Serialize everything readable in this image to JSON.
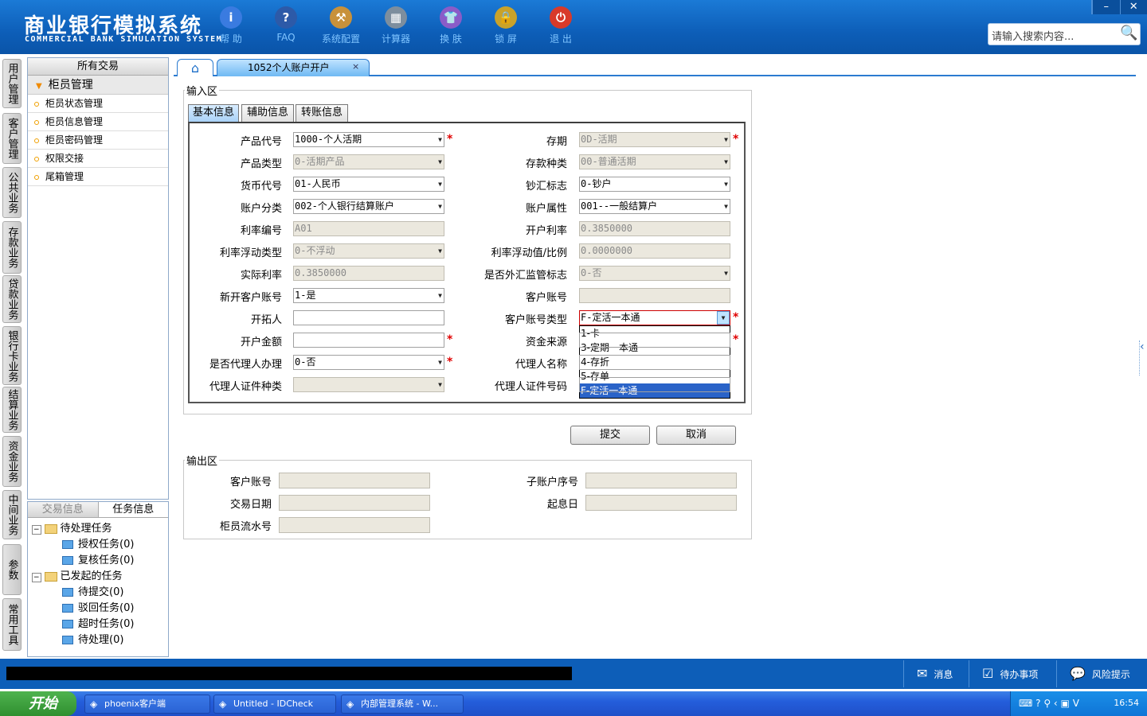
{
  "header": {
    "title_cn": "商业银行模拟系统",
    "title_en": "COMMERCIAL BANK SIMULATION SYSTEM",
    "tools": [
      {
        "label": "帮 助",
        "icon": "info-icon",
        "glyph": "i",
        "color": "#3a7be0"
      },
      {
        "label": "FAQ",
        "icon": "help-icon",
        "glyph": "?",
        "color": "#2d5aa8"
      },
      {
        "label": "系统配置",
        "icon": "toolbox-icon",
        "glyph": "⚒",
        "color": "#c8913a"
      },
      {
        "label": "计算器",
        "icon": "calculator-icon",
        "glyph": "▦",
        "color": "#7d8e9e"
      },
      {
        "label": "换 肤",
        "icon": "tshirt-icon",
        "glyph": "👕",
        "color": "#8a5cc8"
      },
      {
        "label": "锁 屏",
        "icon": "lock-icon",
        "glyph": "🔒",
        "color": "#c9a22a"
      },
      {
        "label": "退 出",
        "icon": "power-icon",
        "glyph": "⏻",
        "color": "#d83a2a"
      }
    ],
    "search_placeholder": "请输入搜索内容...",
    "win_min": "–",
    "win_close": "✕"
  },
  "left_tabs": [
    "用户管理",
    "客户管理",
    "公共业务",
    "存款业务",
    "贷款业务",
    "银行卡业务",
    "结算业务",
    "资金业务",
    "中间业务",
    "参数",
    "常用工具"
  ],
  "menu": {
    "title": "所有交易",
    "group": "柜员管理",
    "items": [
      "柜员状态管理",
      "柜员信息管理",
      "柜员密码管理",
      "权限交接",
      "尾箱管理"
    ]
  },
  "task_panel": {
    "tabs": [
      "交易信息",
      "任务信息"
    ],
    "pending_label": "待处理任务",
    "pending": [
      "授权任务(0)",
      "复核任务(0)"
    ],
    "initiated_label": "已发起的任务",
    "initiated": [
      "待提交(0)",
      "驳回任务(0)",
      "超时任务(0)",
      "待处理(0)"
    ]
  },
  "tabs": {
    "home": "⌂",
    "current": "1052个人账户开户",
    "close": "×"
  },
  "input_area": {
    "legend": "输入区",
    "subtabs": [
      "基本信息",
      "辅助信息",
      "转账信息"
    ],
    "left": [
      {
        "label": "产品代号",
        "value": "1000-个人活期",
        "ro": false,
        "dd": true,
        "req": true
      },
      {
        "label": "产品类型",
        "value": "0-活期产品",
        "ro": true,
        "dd": true,
        "req": false
      },
      {
        "label": "货币代号",
        "value": "01-人民币",
        "ro": false,
        "dd": true,
        "req": false
      },
      {
        "label": "账户分类",
        "value": "002-个人银行结算账户",
        "ro": false,
        "dd": true,
        "req": false
      },
      {
        "label": "利率编号",
        "value": "A01",
        "ro": true,
        "dd": false,
        "req": false
      },
      {
        "label": "利率浮动类型",
        "value": "0-不浮动",
        "ro": true,
        "dd": true,
        "req": false
      },
      {
        "label": "实际利率",
        "value": "0.3850000",
        "ro": true,
        "dd": false,
        "req": false
      },
      {
        "label": "新开客户账号",
        "value": "1-是",
        "ro": false,
        "dd": true,
        "req": false
      },
      {
        "label": "开拓人",
        "value": "",
        "ro": false,
        "dd": false,
        "req": false
      },
      {
        "label": "开户金额",
        "value": "",
        "ro": false,
        "dd": false,
        "req": true
      },
      {
        "label": "是否代理人办理",
        "value": "0-否",
        "ro": false,
        "dd": true,
        "req": true
      },
      {
        "label": "代理人证件种类",
        "value": "",
        "ro": true,
        "dd": true,
        "req": false
      }
    ],
    "right": [
      {
        "label": "存期",
        "value": "0D-活期",
        "ro": true,
        "dd": true,
        "req": true
      },
      {
        "label": "存款种类",
        "value": "00-普通活期",
        "ro": true,
        "dd": true,
        "req": false
      },
      {
        "label": "钞汇标志",
        "value": "0-钞户",
        "ro": false,
        "dd": true,
        "req": false
      },
      {
        "label": "账户属性",
        "value": "001--一般结算户",
        "ro": false,
        "dd": true,
        "req": false
      },
      {
        "label": "开户利率",
        "value": "0.3850000",
        "ro": true,
        "dd": false,
        "req": false
      },
      {
        "label": "利率浮动值/比例",
        "value": "0.0000000",
        "ro": true,
        "dd": false,
        "req": false
      },
      {
        "label": "是否外汇监管标志",
        "value": "0-否",
        "ro": true,
        "dd": true,
        "req": false
      },
      {
        "label": "客户账号",
        "value": "",
        "ro": true,
        "dd": false,
        "req": false
      },
      {
        "label": "客户账号类型",
        "value": "F-定活一本通",
        "ro": false,
        "dd": true,
        "req": true
      },
      {
        "label": "资金来源",
        "value": "",
        "ro": false,
        "dd": false,
        "req": true
      },
      {
        "label": "代理人名称",
        "value": "",
        "ro": false,
        "dd": false,
        "req": false
      },
      {
        "label": "代理人证件号码",
        "value": "",
        "ro": false,
        "dd": false,
        "req": false
      }
    ],
    "dropdown_options": [
      "1-卡",
      "3-定期一本通",
      "4-存折",
      "5-存单",
      "F-定活一本通"
    ],
    "dropdown_selected": "F-定活一本通"
  },
  "buttons": {
    "submit": "提交",
    "cancel": "取消"
  },
  "output_area": {
    "legend": "输出区",
    "left": [
      "客户账号",
      "交易日期",
      "柜员流水号"
    ],
    "right": [
      "子账户序号",
      "起息日"
    ]
  },
  "status_bar": {
    "items": [
      {
        "label": "消息",
        "icon": "mail-icon",
        "glyph": "✉"
      },
      {
        "label": "待办事项",
        "icon": "checkbox-icon",
        "glyph": "☑"
      },
      {
        "label": "风险提示",
        "icon": "chat-bubble-icon",
        "glyph": "💬"
      }
    ]
  },
  "taskbar": {
    "start": "开始",
    "apps": [
      "phoenix客户端",
      "Untitled - IDCheck",
      "内部管理系统 - W..."
    ],
    "clock": "16:54"
  }
}
